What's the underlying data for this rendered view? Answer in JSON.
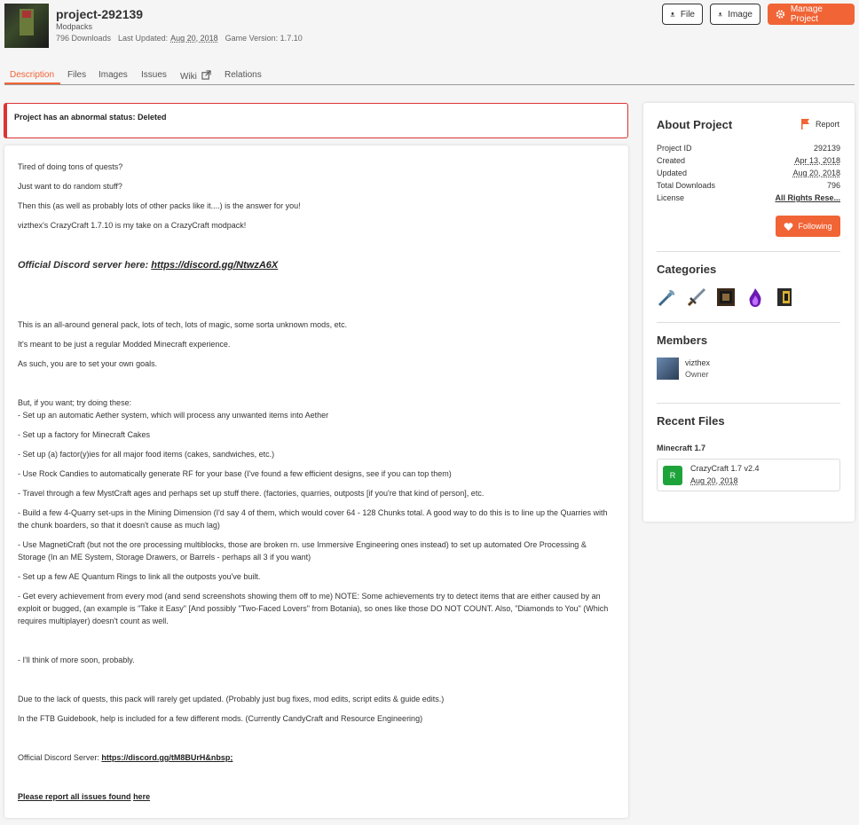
{
  "project": {
    "name": "project-292139",
    "category": "Modpacks",
    "downloads": "796 Downloads",
    "last_updated_label": "Last Updated:",
    "last_updated": "Aug 20, 2018",
    "game_version": "Game Version: 1.7.10"
  },
  "header_buttons": {
    "file": "File",
    "image": "Image",
    "manage": "Manage Project"
  },
  "tabs": [
    "Description",
    "Files",
    "Images",
    "Issues",
    "Wiki",
    "Relations"
  ],
  "alert": "Project has an abnormal status: Deleted",
  "description": {
    "p1": "Tired of doing tons of quests?",
    "p2": "Just want to do random stuff?",
    "p3": "Then this (as well as probably lots of other packs like it....) is the answer for you!",
    "p4": "vizthex's CrazyCraft 1.7.10 is my take on a CrazyCraft modpack!",
    "discord_big_label": "Official Discord server here:",
    "discord_big_link": "https://discord.gg/NtwzA6X",
    "p5": "This is an all-around general pack, lots of tech, lots of magic, some sorta unknown mods, etc.",
    "p6": "It's meant to be just a regular Modded Minecraft experience.",
    "p7": "As such, you are to set your own goals.",
    "p8a": "But, if you want; try doing these:",
    "p8b": "- Set up an automatic Aether system, which will process any unwanted items into Aether",
    "p9": "- Set up a factory for Minecraft Cakes",
    "p10": "- Set up (a) factor(y)ies for all major food items (cakes, sandwiches, etc.)",
    "p11": "- Use Rock Candies to automatically generate RF for your base (I've found a few efficient designs, see if you can top them)",
    "p12": "- Travel through a few MystCraft ages and perhaps set up stuff there. (factories, quarries, outposts [if you're that kind of person], etc.",
    "p13": "- Build a few 4-Quarry set-ups in the Mining Dimension (I'd say 4 of them, which would cover 64 - 128 Chunks total. A good way to do this is to line up the Quarries with the chunk boarders, so that it doesn't cause as much lag)",
    "p14": "- Use MagnetiCraft (but not the ore processing multiblocks, those are broken rn. use Immersive Engineering ones instead) to set up automated Ore Processing & Storage (In an ME System, Storage Drawers, or Barrels - perhaps all 3 if you want)",
    "p15": "- Set up a few AE Quantum Rings to link all the outposts you've built.",
    "p16": "- Get every achievement from every mod (and send screenshots showing them off to me) NOTE: Some achievements try to detect items that are either caused by an exploit or bugged, (an example is \"Take it Easy\" [And possibly \"Two-Faced Lovers\" from Botania), so ones like those DO NOT COUNT. Also, \"Diamonds to You\" (Which requires multiplayer) doesn't count as well.",
    "p17": "- I'll think of more soon, probably.",
    "p18": "Due to the lack of quests, this pack will rarely get updated. (Probably just bug fixes, mod edits, script edits & guide edits.)",
    "p19": "In the FTB Guidebook, help is included for a few different mods. (Currently CandyCraft and Resource Engineering)",
    "discord2_label": "Official Discord Server:",
    "discord2_link": "https://discord.gg/tM8BUrH&nbsp;",
    "report_text": "Please report all issues found",
    "report_link": "here"
  },
  "about": {
    "title": "About Project",
    "report": "Report",
    "rows": [
      {
        "k": "Project ID",
        "v": "292139"
      },
      {
        "k": "Created",
        "v": "Apr 13, 2018"
      },
      {
        "k": "Updated",
        "v": "Aug 20, 2018"
      },
      {
        "k": "Total Downloads",
        "v": "796"
      },
      {
        "k": "License",
        "v": "All Rights Rese..."
      }
    ],
    "follow": "Following"
  },
  "categories": {
    "title": "Categories",
    "icons": [
      "wrench-icon",
      "sword-icon",
      "crafting-block-icon",
      "magic-flame-icon",
      "storage-block-icon"
    ]
  },
  "members": {
    "title": "Members",
    "name": "vizthex",
    "role": "Owner"
  },
  "recent_files": {
    "title": "Recent Files",
    "version": "Minecraft 1.7",
    "badge": "R",
    "file_name": "CrazyCraft 1.7 v2.4",
    "file_date": "Aug 20, 2018"
  },
  "colors": {
    "accent": "#f16436",
    "alert": "#dd3333",
    "release": "#1ea33b"
  }
}
